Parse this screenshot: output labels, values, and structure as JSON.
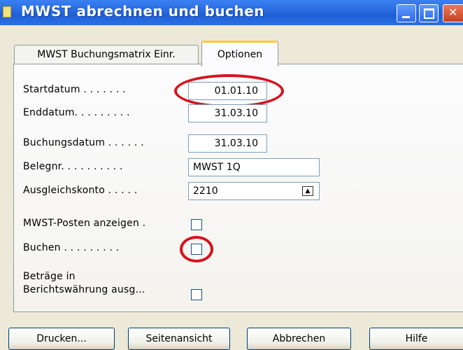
{
  "window": {
    "title": "MWST abrechnen und buchen"
  },
  "tabs": [
    {
      "label": "MWST Buchungsmatrix Einr.",
      "active": false
    },
    {
      "label": "Optionen",
      "active": true
    }
  ],
  "form": {
    "startdatum": {
      "label": "Startdatum . . . . . . .",
      "value": "01.01.10",
      "highlighted": true
    },
    "enddatum": {
      "label": "Enddatum. . . . . . . . .",
      "value": "31.03.10"
    },
    "buchungsdatum": {
      "label": "Buchungsdatum . . . . . .",
      "value": "31.03.10"
    },
    "belegnr": {
      "label": "Belegnr. . . . . . . . . .",
      "value": "MWST 1Q"
    },
    "ausgleichskonto": {
      "label": "Ausgleichskonto . . . . .",
      "value": "2210"
    },
    "mwst_posten": {
      "label": "MWST-Posten anzeigen .",
      "checked": false
    },
    "buchen": {
      "label": "Buchen . . . . . . . . .",
      "checked": false,
      "highlighted": true
    },
    "betraege": {
      "label_line1": "Beträge in",
      "label_line2": "Berichtswährung ausg...",
      "checked": false
    }
  },
  "buttons": {
    "drucken": "Drucken...",
    "seitenansicht": "Seitenansicht",
    "abbrechen": "Abbrechen",
    "hilfe": "Hilfe"
  },
  "colors": {
    "highlight_circle": "#d5121d",
    "titlebar": "#2a6be0",
    "tab_accent": "#ffc83c"
  }
}
